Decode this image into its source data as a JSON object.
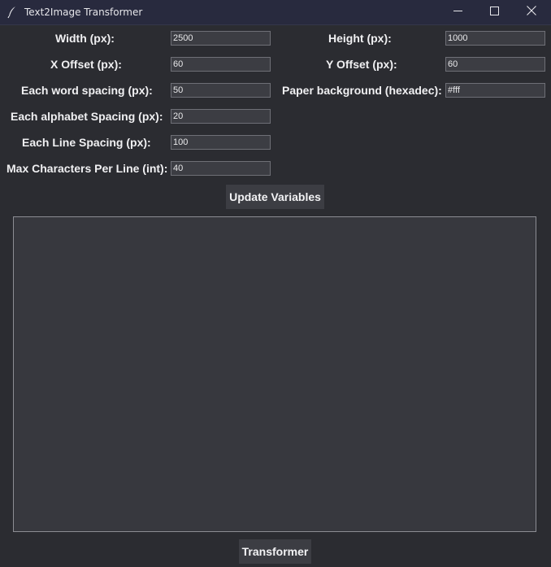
{
  "window": {
    "title": "Text2Image Transformer",
    "minimize_icon": "minimize-icon",
    "maximize_icon": "maximize-icon",
    "close_icon": "close-icon",
    "app_icon": "feather-icon"
  },
  "form": {
    "width": {
      "label": "Width (px):",
      "value": "2500"
    },
    "height": {
      "label": "Height (px):",
      "value": "1000"
    },
    "x_offset": {
      "label": "X Offset (px):",
      "value": "60"
    },
    "y_offset": {
      "label": "Y Offset (px):",
      "value": "60"
    },
    "word_spacing": {
      "label": "Each word spacing (px):",
      "value": "50"
    },
    "paper_background": {
      "label": "Paper background (hexadec):",
      "value": "#fff"
    },
    "alphabet_spacing": {
      "label": "Each alphabet Spacing (px):",
      "value": "20"
    },
    "line_spacing": {
      "label": "Each Line Spacing (px):",
      "value": "100"
    },
    "max_chars": {
      "label": "Max Characters Per Line (int):",
      "value": "40"
    }
  },
  "buttons": {
    "update_label": "Update Variables",
    "transform_label": "Transformer"
  },
  "text_input": {
    "value": ""
  },
  "colors": {
    "background": "#2b2c31",
    "titlebar": "#282a3e",
    "input_bg": "#3c3d43",
    "text": "#f0f0f2"
  }
}
